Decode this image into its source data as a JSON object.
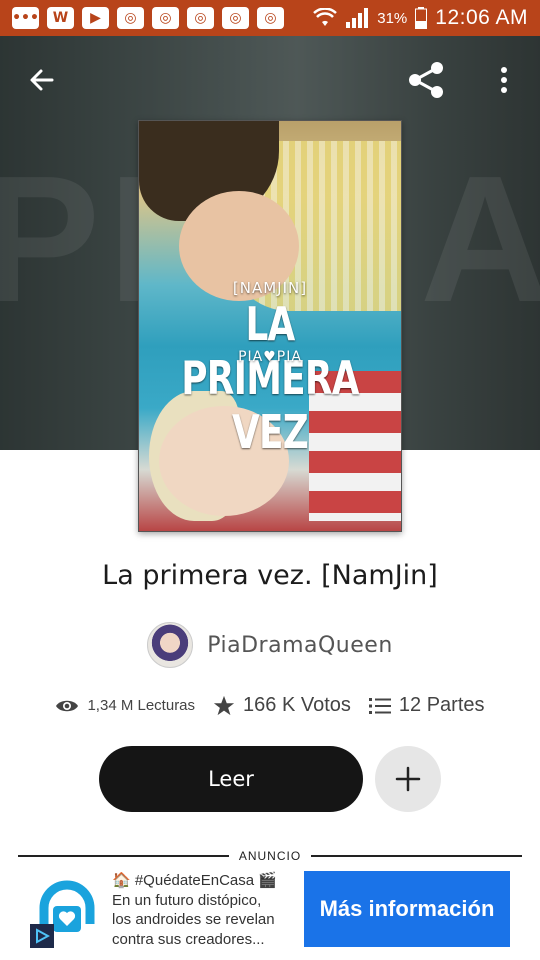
{
  "status_bar": {
    "app_icons": [
      "message-icon",
      "w-icon",
      "youtube-icon",
      "chat-icon",
      "chat-icon",
      "chat-icon",
      "chat-icon",
      "chat-icon"
    ],
    "battery_percent": "31%",
    "time": "12:06 AM",
    "color": "#b8441a"
  },
  "toolbar": {
    "back_icon": "arrow-left-icon",
    "share_icon": "share-icon",
    "more_icon": "more-vertical-icon"
  },
  "cover": {
    "tag": "[NAMJIN]",
    "title": "LA PRIMERA VEZ",
    "author": "PIA♥PIA"
  },
  "story": {
    "title": "La primera vez. [NamJin]",
    "author": "PiaDramaQueen"
  },
  "stats": {
    "reads": "1,34 M Lecturas",
    "votes": "166 K Votos",
    "parts": "12 Partes"
  },
  "actions": {
    "read_label": "Leer",
    "add_icon": "plus-icon"
  },
  "ad": {
    "label": "ANUNCIO",
    "line1": "🏠 #QuédateEnCasa 🎬",
    "line2": "En un futuro distópico,",
    "line3": "los androides se revelan",
    "line4": "contra sus creadores...",
    "cta": "Más información",
    "cta_color": "#1a73e8"
  }
}
